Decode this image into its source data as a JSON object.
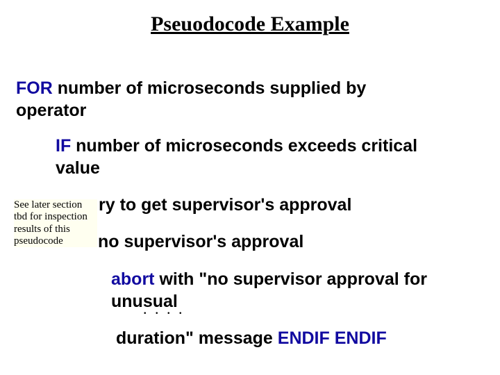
{
  "title": "Pseuodocode Example",
  "l1": {
    "kw": "FOR",
    "rest": " number of microseconds supplied by"
  },
  "l2": "operator",
  "l3": {
    "kw": "IF",
    "rest": " number of microseconds exceeds critical"
  },
  "l4": "value",
  "l5_frag": "ry to get supervisor's approval",
  "l6_frag": " no supervisor's approval",
  "l7": {
    "kw": "abort",
    "rest": " with \"no supervisor approval for"
  },
  "l8": "unusual",
  "l9": {
    "text": "duration\" message ",
    "kws": "ENDIF ENDIF"
  },
  "note": "See later section tbd for inspection results of this pseudocode",
  "dots": ". . . ."
}
